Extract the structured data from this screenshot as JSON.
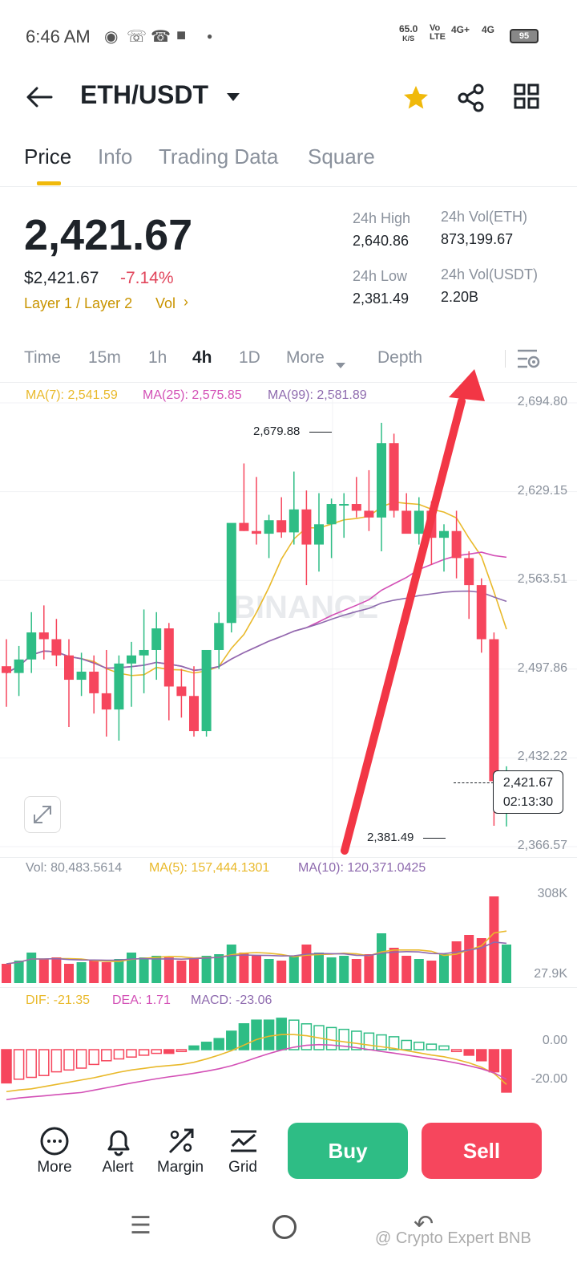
{
  "status_bar": {
    "time": "6:46 AM",
    "speed_value": "65.0",
    "speed_unit": "K/S",
    "volte": "Vo LTE",
    "net1": "4G+",
    "net2": "4G",
    "battery": "95"
  },
  "header": {
    "title": "ETH/USDT",
    "icons": [
      "back-arrow-icon",
      "caret-down-icon",
      "star-icon",
      "share-icon",
      "grid-icon"
    ],
    "star_color": "#f0b90b"
  },
  "tabs": [
    {
      "label": "Price",
      "active": true
    },
    {
      "label": "Info",
      "active": false
    },
    {
      "label": "Trading Data",
      "active": false
    },
    {
      "label": "Square",
      "active": false
    }
  ],
  "ticker": {
    "last_price": "2,421.67",
    "usd_price": "$2,421.67",
    "change_pct": "-7.14%",
    "tag_layer": "Layer 1 / Layer 2",
    "tag_vol": "Vol",
    "stats": {
      "high_label": "24h High",
      "high_value": "2,640.86",
      "low_label": "24h Low",
      "low_value": "2,381.49",
      "vol_eth_label": "24h Vol(ETH)",
      "vol_eth_value": "873,199.67",
      "vol_usdt_label": "24h Vol(USDT)",
      "vol_usdt_value": "2.20B"
    }
  },
  "intervals": [
    "Time",
    "15m",
    "1h",
    "4h",
    "1D",
    "More",
    "Depth"
  ],
  "active_interval": "4h",
  "ma_legend": {
    "ma7": "MA(7): 2,541.59",
    "ma25": "MA(25): 2,575.85",
    "ma99": "MA(99): 2,581.89"
  },
  "watermark": "BINANCE",
  "price_marker": {
    "price": "2,421.67",
    "countdown": "02:13:30"
  },
  "high_marker": "2,679.88",
  "low_marker": "2,381.49",
  "volume_legend": {
    "vol": "Vol: 80,483.5614",
    "ma5": "MA(5): 157,444.1301",
    "ma10": "MA(10): 120,371.0425"
  },
  "macd_legend": {
    "dif": "DIF: -21.35",
    "dea": "DEA: 1.71",
    "macd": "MACD: -23.06"
  },
  "bottom_bar": {
    "more": "More",
    "alert": "Alert",
    "margin": "Margin",
    "grid": "Grid",
    "buy": "Buy",
    "sell": "Sell"
  },
  "credit": "@ Crypto Expert BNB",
  "colors": {
    "up": "#2ebd85",
    "down": "#f6465d",
    "ma7": "#e9b92b",
    "ma25": "#d350b6",
    "ma99": "#8e6aae",
    "accent": "#f0b90b"
  },
  "chart_data": {
    "type": "candlestick",
    "interval": "4h",
    "y_axis_ticks": [
      "2,694.80",
      "2,629.15",
      "2,563.51",
      "2,497.86",
      "2,432.22",
      "2,366.57"
    ],
    "ylim": [
      2366.57,
      2694.8
    ],
    "candles": [
      {
        "o": 2500,
        "h": 2520,
        "l": 2470,
        "c": 2495
      },
      {
        "o": 2495,
        "h": 2515,
        "l": 2478,
        "c": 2505
      },
      {
        "o": 2505,
        "h": 2540,
        "l": 2495,
        "c": 2525
      },
      {
        "o": 2525,
        "h": 2545,
        "l": 2505,
        "c": 2520
      },
      {
        "o": 2520,
        "h": 2535,
        "l": 2500,
        "c": 2508
      },
      {
        "o": 2508,
        "h": 2520,
        "l": 2455,
        "c": 2490
      },
      {
        "o": 2490,
        "h": 2510,
        "l": 2478,
        "c": 2496
      },
      {
        "o": 2496,
        "h": 2508,
        "l": 2465,
        "c": 2480
      },
      {
        "o": 2480,
        "h": 2512,
        "l": 2448,
        "c": 2468
      },
      {
        "o": 2468,
        "h": 2508,
        "l": 2445,
        "c": 2502
      },
      {
        "o": 2502,
        "h": 2518,
        "l": 2470,
        "c": 2508
      },
      {
        "o": 2508,
        "h": 2542,
        "l": 2480,
        "c": 2512
      },
      {
        "o": 2512,
        "h": 2540,
        "l": 2490,
        "c": 2528
      },
      {
        "o": 2528,
        "h": 2532,
        "l": 2460,
        "c": 2485
      },
      {
        "o": 2485,
        "h": 2498,
        "l": 2462,
        "c": 2478
      },
      {
        "o": 2478,
        "h": 2500,
        "l": 2448,
        "c": 2452
      },
      {
        "o": 2452,
        "h": 2505,
        "l": 2448,
        "c": 2512
      },
      {
        "o": 2512,
        "h": 2540,
        "l": 2498,
        "c": 2532
      },
      {
        "o": 2532,
        "h": 2580,
        "l": 2525,
        "c": 2606
      },
      {
        "o": 2606,
        "h": 2650,
        "l": 2600,
        "c": 2600
      },
      {
        "o": 2600,
        "h": 2640,
        "l": 2590,
        "c": 2598
      },
      {
        "o": 2598,
        "h": 2612,
        "l": 2580,
        "c": 2608
      },
      {
        "o": 2608,
        "h": 2625,
        "l": 2595,
        "c": 2599
      },
      {
        "o": 2599,
        "h": 2644,
        "l": 2590,
        "c": 2616
      },
      {
        "o": 2616,
        "h": 2630,
        "l": 2560,
        "c": 2590
      },
      {
        "o": 2590,
        "h": 2628,
        "l": 2570,
        "c": 2605
      },
      {
        "o": 2605,
        "h": 2624,
        "l": 2580,
        "c": 2620
      },
      {
        "o": 2620,
        "h": 2628,
        "l": 2595,
        "c": 2620
      },
      {
        "o": 2620,
        "h": 2640,
        "l": 2610,
        "c": 2615
      },
      {
        "o": 2615,
        "h": 2645,
        "l": 2600,
        "c": 2610
      },
      {
        "o": 2610,
        "h": 2680,
        "l": 2585,
        "c": 2665
      },
      {
        "o": 2665,
        "h": 2672,
        "l": 2610,
        "c": 2615
      },
      {
        "o": 2615,
        "h": 2628,
        "l": 2600,
        "c": 2598
      },
      {
        "o": 2598,
        "h": 2625,
        "l": 2590,
        "c": 2615
      },
      {
        "o": 2615,
        "h": 2622,
        "l": 2575,
        "c": 2595
      },
      {
        "o": 2595,
        "h": 2605,
        "l": 2570,
        "c": 2600
      },
      {
        "o": 2600,
        "h": 2615,
        "l": 2565,
        "c": 2580
      },
      {
        "o": 2580,
        "h": 2585,
        "l": 2535,
        "c": 2560
      },
      {
        "o": 2560,
        "h": 2565,
        "l": 2510,
        "c": 2520
      },
      {
        "o": 2520,
        "h": 2525,
        "l": 2382,
        "c": 2415
      },
      {
        "o": 2415,
        "h": 2426,
        "l": 2381.49,
        "c": 2421.67
      }
    ],
    "volume_axis": [
      "308K",
      "27.9K"
    ],
    "volumes": [
      60,
      70,
      95,
      75,
      80,
      60,
      65,
      70,
      65,
      75,
      95,
      80,
      85,
      80,
      70,
      75,
      85,
      90,
      120,
      95,
      85,
      75,
      70,
      85,
      120,
      95,
      80,
      85,
      75,
      90,
      155,
      110,
      85,
      75,
      70,
      90,
      130,
      150,
      140,
      270,
      120
    ],
    "macd_axis": [
      "0.00",
      "-20.00"
    ],
    "macd": [
      -18,
      -16,
      -15,
      -14,
      -12,
      -11,
      -10,
      -8,
      -6,
      -5,
      -4,
      -3,
      -2,
      -2,
      -1,
      2,
      4,
      6,
      10,
      14,
      16,
      16,
      17,
      16,
      14,
      13,
      12,
      11,
      10,
      9,
      8,
      7,
      5,
      4,
      3,
      2,
      -1,
      -3,
      -6,
      -12,
      -23
    ]
  }
}
